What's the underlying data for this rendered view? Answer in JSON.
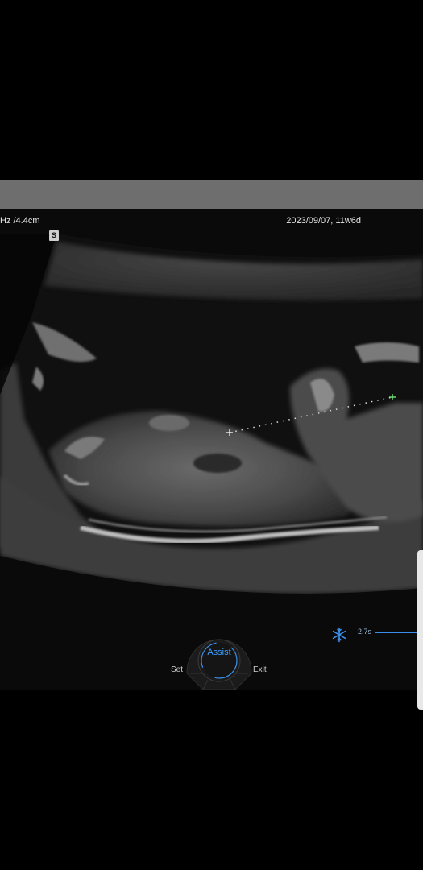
{
  "header": {
    "left_info": "Hz /4.4cm",
    "right_info": "2023/09/07, 11w6d",
    "s_badge": "S"
  },
  "controls": {
    "assist_label": "Assist",
    "set_label": "Set",
    "exit_label": "Exit",
    "cine_time": "2.7s",
    "freeze_icon": "snowflake-icon"
  },
  "colors": {
    "accent": "#3a8ee8",
    "caliper_end": "#7dff7d"
  }
}
